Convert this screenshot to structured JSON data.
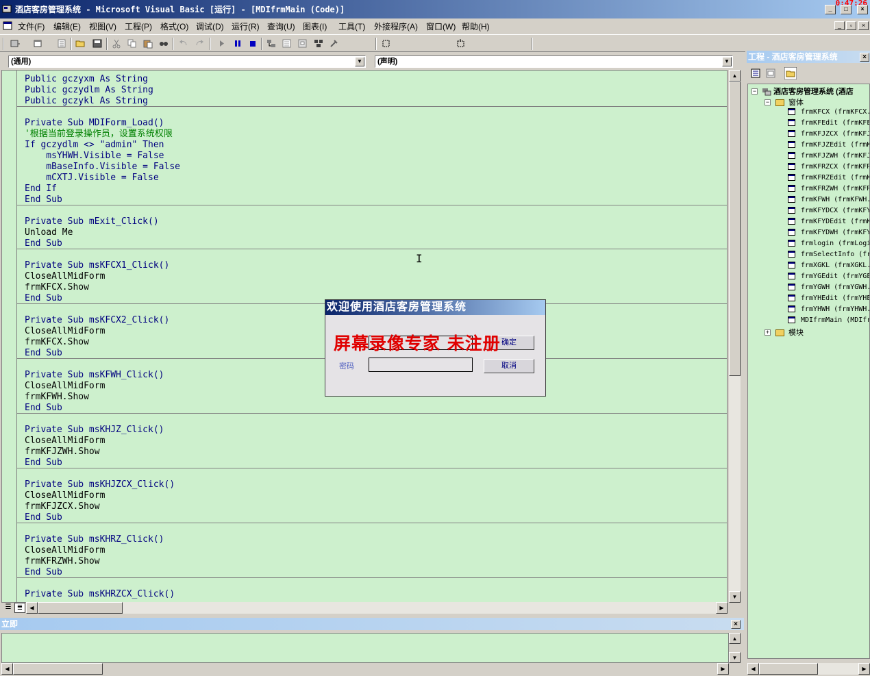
{
  "window": {
    "title": "酒店客房管理系统 - Microsoft Visual Basic [运行] - [MDIfrmMain (Code)]",
    "timer": "0:47:26",
    "minimize": "_",
    "maximize": "□",
    "close": "×"
  },
  "menu": {
    "items": [
      "文件(F)",
      "编辑(E)",
      "视图(V)",
      "工程(P)",
      "格式(O)",
      "调试(D)",
      "运行(R)",
      "查询(U)",
      "图表(I)",
      "工具(T)",
      "外接程序(A)",
      "窗口(W)",
      "帮助(H)"
    ]
  },
  "code_window": {
    "object_combo": "(通用)",
    "procedure_combo": "(声明)",
    "lines": [
      "Public gczyxm As String",
      "Public gczydlm As String",
      "Public gczykl As String",
      "",
      "Private Sub MDIForm_Load()",
      "'根据当前登录操作员，设置系统权限",
      "If gczydlm <> \"admin\" Then",
      "    msYHWH.Visible = False",
      "    mBaseInfo.Visible = False",
      "    mCXTJ.Visible = False",
      "End If",
      "End Sub",
      "",
      "Private Sub mExit_Click()",
      "Unload Me",
      "End Sub",
      "",
      "Private Sub msKFCX1_Click()",
      "CloseAllMidForm",
      "frmKFCX.Show",
      "End Sub",
      "",
      "Private Sub msKFCX2_Click()",
      "CloseAllMidForm",
      "frmKFCX.Show",
      "End Sub",
      "",
      "Private Sub msKFWH_Click()",
      "CloseAllMidForm",
      "frmKFWH.Show",
      "End Sub",
      "",
      "Private Sub msKHJZ_Click()",
      "CloseAllMidForm",
      "frmKFJZWH.Show",
      "End Sub",
      "",
      "Private Sub msKHJZCX_Click()",
      "CloseAllMidForm",
      "frmKFJZCX.Show",
      "End Sub",
      "",
      "Private Sub msKHRZ_Click()",
      "CloseAllMidForm",
      "frmKFRZWH.Show",
      "End Sub",
      "",
      "Private Sub msKHRZCX_Click()"
    ],
    "line_kinds": [
      "kw",
      "kw",
      "kw",
      "kw",
      "kw",
      "comment",
      "kw",
      "kw",
      "kw",
      "kw",
      "kw",
      "kw",
      "kw",
      "kw",
      "plain",
      "kw",
      "kw",
      "kw",
      "plain",
      "plain",
      "kw",
      "kw",
      "kw",
      "plain",
      "plain",
      "kw",
      "kw",
      "kw",
      "plain",
      "plain",
      "kw",
      "kw",
      "kw",
      "plain",
      "plain",
      "kw",
      "kw",
      "kw",
      "plain",
      "plain",
      "kw",
      "kw",
      "kw",
      "plain",
      "plain",
      "kw",
      "kw",
      "kw"
    ]
  },
  "immediate": {
    "title": "立即"
  },
  "project": {
    "title": "工程 - 酒店客房管理系统",
    "root": "酒店客房管理系统 (酒店",
    "forms_folder": "窗体",
    "forms": [
      "frmKFCX (frmKFCX.",
      "frmKFEdit (frmKFE",
      "frmKFJZCX (frmKFJ",
      "frmKFJZEdit (frmK",
      "frmKFJZWH (frmKFJ",
      "frmKFRZCX (frmKFR",
      "frmKFRZEdit (frmK",
      "frmKFRZWH (frmKFR",
      "frmKFWH (frmKFWH.",
      "frmKFYDCX (frmKFY",
      "frmKFYDEdit (frmK",
      "frmKFYDWH (frmKFY",
      "frmlogin (frmLogi",
      "frmSelectInfo (fr",
      "frmXGKL (frmXGKL.",
      "frmYGEdit (frmYGE",
      "frmYGWH (frmYGWH.",
      "frmYHEdit (frmYHE",
      "frmYHWH (frmYHWH.",
      "MDIfrmMain (MDIfr"
    ],
    "modules_folder": "模块"
  },
  "login_dialog": {
    "title": "欢迎使用酒店客房管理系统",
    "password_label": "密码",
    "cancel_label": "取消",
    "ok_label": "确定"
  },
  "watermark": "屏幕录像专家  未注册",
  "icons": [
    "app-icon",
    "close-icon",
    "minimize-icon",
    "maximize-icon",
    "folder-icon",
    "form-icon",
    "run-icon",
    "pause-icon",
    "stop-icon"
  ]
}
